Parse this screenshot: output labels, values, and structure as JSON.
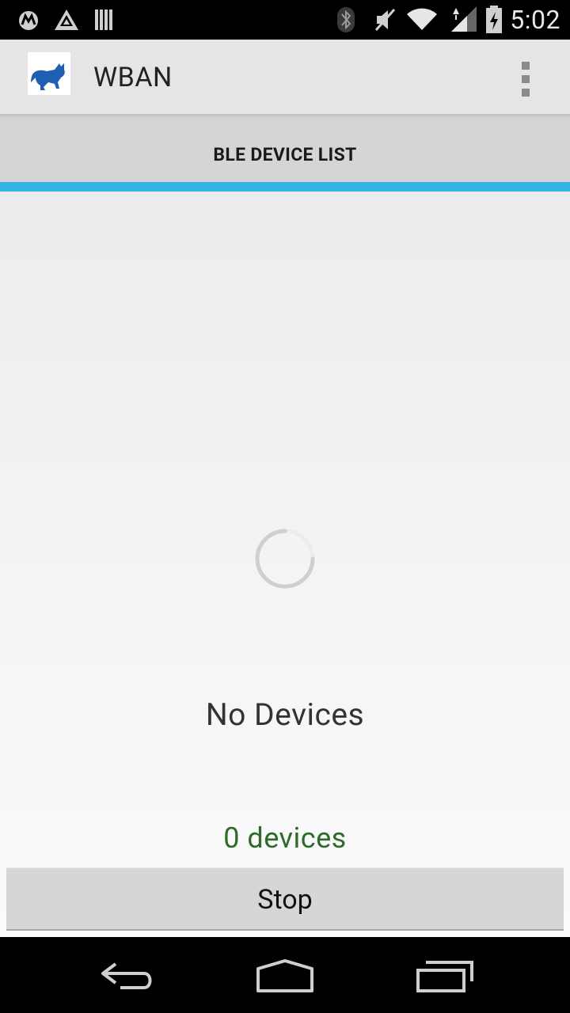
{
  "status_bar": {
    "time": "5:02",
    "icons": [
      "motorola-icon",
      "app-notification-icon",
      "barcode-notification-icon",
      "bluetooth-icon",
      "mute-icon",
      "wifi-icon",
      "signal-icon",
      "battery-icon"
    ]
  },
  "app": {
    "title": "WBAN",
    "logo_icon": "cat-logo-icon",
    "overflow_icon": "overflow-menu-icon"
  },
  "tabs": [
    {
      "label": "BLE DEVICE LIST",
      "selected": true
    }
  ],
  "content": {
    "empty_text": "No Devices",
    "count_text": "0 devices",
    "stop_label": "Stop"
  },
  "colors": {
    "accent": "#33b5e5",
    "count_text": "#2e6b2a",
    "action_bar": "#e5e5e5"
  },
  "nav": {
    "icons": [
      "back-icon",
      "home-icon",
      "recent-apps-icon"
    ]
  }
}
